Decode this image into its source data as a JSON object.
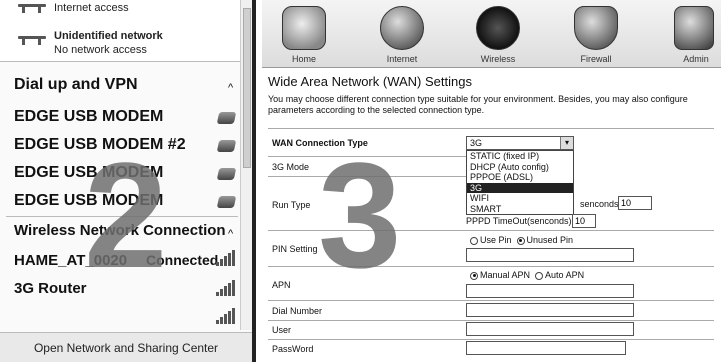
{
  "left_panel": {
    "internet_access": "Internet access",
    "unidentified": "Unidentified network",
    "no_access": "No network access",
    "dialup_title": "Dial up and VPN",
    "modems": [
      "EDGE USB MODEM",
      "EDGE USB MODEM #2",
      "EDGE USB MODEM",
      "EDGE USB MODEM"
    ],
    "wireless_title": "Wireless Network Connection",
    "ssid1": "HAME_AT_0020",
    "ssid1_status": "Connected",
    "ssid2": "3G Router",
    "footer": "Open Network and Sharing Center",
    "chevron": "^"
  },
  "router": {
    "tabs": [
      "Home",
      "Internet",
      "Wireless",
      "Firewall",
      "Admin"
    ],
    "title": "Wide Area Network (WAN) Settings",
    "desc": "You may choose different connection type suitable for your environment. Besides, you may also configure parameters according to the selected connection type.",
    "labels": {
      "wan_type": "WAN Connection Type",
      "mode_3g": "3G Mode",
      "run_type": "Run Type",
      "pin": "PIN Setting",
      "apn": "APN",
      "dial": "Dial Number",
      "user": "User",
      "pass": "PassWord"
    },
    "select_value": "3G",
    "options": [
      "STATIC (fixed IP)",
      "DHCP (Auto config)",
      "PPPOE (ADSL)",
      "3G",
      "WIFI",
      "SMART"
    ],
    "selected_option_index": 3,
    "reconnect_suffix": "senconds)",
    "reconnect_value": "10",
    "pppd_label": "PPPD TimeOut(senconds)",
    "pppd_value": "10",
    "use_pin": "Use Pin",
    "unused_pin": "Unused Pin",
    "manual_apn": "Manual APN",
    "auto_apn": "Auto APN"
  },
  "overlay": {
    "step_left": "2",
    "step_right": "3"
  }
}
